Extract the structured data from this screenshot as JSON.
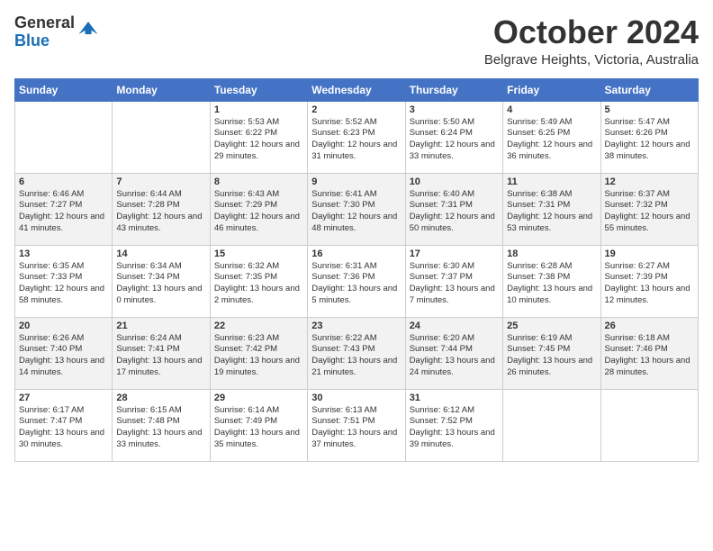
{
  "logo": {
    "line1": "General",
    "line2": "Blue",
    "tagline": ""
  },
  "header": {
    "month": "October 2024",
    "location": "Belgrave Heights, Victoria, Australia"
  },
  "weekdays": [
    "Sunday",
    "Monday",
    "Tuesday",
    "Wednesday",
    "Thursday",
    "Friday",
    "Saturday"
  ],
  "weeks": [
    [
      {
        "day": "",
        "content": ""
      },
      {
        "day": "",
        "content": ""
      },
      {
        "day": "1",
        "content": "Sunrise: 5:53 AM\nSunset: 6:22 PM\nDaylight: 12 hours and 29 minutes."
      },
      {
        "day": "2",
        "content": "Sunrise: 5:52 AM\nSunset: 6:23 PM\nDaylight: 12 hours and 31 minutes."
      },
      {
        "day": "3",
        "content": "Sunrise: 5:50 AM\nSunset: 6:24 PM\nDaylight: 12 hours and 33 minutes."
      },
      {
        "day": "4",
        "content": "Sunrise: 5:49 AM\nSunset: 6:25 PM\nDaylight: 12 hours and 36 minutes."
      },
      {
        "day": "5",
        "content": "Sunrise: 5:47 AM\nSunset: 6:26 PM\nDaylight: 12 hours and 38 minutes."
      }
    ],
    [
      {
        "day": "6",
        "content": "Sunrise: 6:46 AM\nSunset: 7:27 PM\nDaylight: 12 hours and 41 minutes."
      },
      {
        "day": "7",
        "content": "Sunrise: 6:44 AM\nSunset: 7:28 PM\nDaylight: 12 hours and 43 minutes."
      },
      {
        "day": "8",
        "content": "Sunrise: 6:43 AM\nSunset: 7:29 PM\nDaylight: 12 hours and 46 minutes."
      },
      {
        "day": "9",
        "content": "Sunrise: 6:41 AM\nSunset: 7:30 PM\nDaylight: 12 hours and 48 minutes."
      },
      {
        "day": "10",
        "content": "Sunrise: 6:40 AM\nSunset: 7:31 PM\nDaylight: 12 hours and 50 minutes."
      },
      {
        "day": "11",
        "content": "Sunrise: 6:38 AM\nSunset: 7:31 PM\nDaylight: 12 hours and 53 minutes."
      },
      {
        "day": "12",
        "content": "Sunrise: 6:37 AM\nSunset: 7:32 PM\nDaylight: 12 hours and 55 minutes."
      }
    ],
    [
      {
        "day": "13",
        "content": "Sunrise: 6:35 AM\nSunset: 7:33 PM\nDaylight: 12 hours and 58 minutes."
      },
      {
        "day": "14",
        "content": "Sunrise: 6:34 AM\nSunset: 7:34 PM\nDaylight: 13 hours and 0 minutes."
      },
      {
        "day": "15",
        "content": "Sunrise: 6:32 AM\nSunset: 7:35 PM\nDaylight: 13 hours and 2 minutes."
      },
      {
        "day": "16",
        "content": "Sunrise: 6:31 AM\nSunset: 7:36 PM\nDaylight: 13 hours and 5 minutes."
      },
      {
        "day": "17",
        "content": "Sunrise: 6:30 AM\nSunset: 7:37 PM\nDaylight: 13 hours and 7 minutes."
      },
      {
        "day": "18",
        "content": "Sunrise: 6:28 AM\nSunset: 7:38 PM\nDaylight: 13 hours and 10 minutes."
      },
      {
        "day": "19",
        "content": "Sunrise: 6:27 AM\nSunset: 7:39 PM\nDaylight: 13 hours and 12 minutes."
      }
    ],
    [
      {
        "day": "20",
        "content": "Sunrise: 6:26 AM\nSunset: 7:40 PM\nDaylight: 13 hours and 14 minutes."
      },
      {
        "day": "21",
        "content": "Sunrise: 6:24 AM\nSunset: 7:41 PM\nDaylight: 13 hours and 17 minutes."
      },
      {
        "day": "22",
        "content": "Sunrise: 6:23 AM\nSunset: 7:42 PM\nDaylight: 13 hours and 19 minutes."
      },
      {
        "day": "23",
        "content": "Sunrise: 6:22 AM\nSunset: 7:43 PM\nDaylight: 13 hours and 21 minutes."
      },
      {
        "day": "24",
        "content": "Sunrise: 6:20 AM\nSunset: 7:44 PM\nDaylight: 13 hours and 24 minutes."
      },
      {
        "day": "25",
        "content": "Sunrise: 6:19 AM\nSunset: 7:45 PM\nDaylight: 13 hours and 26 minutes."
      },
      {
        "day": "26",
        "content": "Sunrise: 6:18 AM\nSunset: 7:46 PM\nDaylight: 13 hours and 28 minutes."
      }
    ],
    [
      {
        "day": "27",
        "content": "Sunrise: 6:17 AM\nSunset: 7:47 PM\nDaylight: 13 hours and 30 minutes."
      },
      {
        "day": "28",
        "content": "Sunrise: 6:15 AM\nSunset: 7:48 PM\nDaylight: 13 hours and 33 minutes."
      },
      {
        "day": "29",
        "content": "Sunrise: 6:14 AM\nSunset: 7:49 PM\nDaylight: 13 hours and 35 minutes."
      },
      {
        "day": "30",
        "content": "Sunrise: 6:13 AM\nSunset: 7:51 PM\nDaylight: 13 hours and 37 minutes."
      },
      {
        "day": "31",
        "content": "Sunrise: 6:12 AM\nSunset: 7:52 PM\nDaylight: 13 hours and 39 minutes."
      },
      {
        "day": "",
        "content": ""
      },
      {
        "day": "",
        "content": ""
      }
    ]
  ]
}
